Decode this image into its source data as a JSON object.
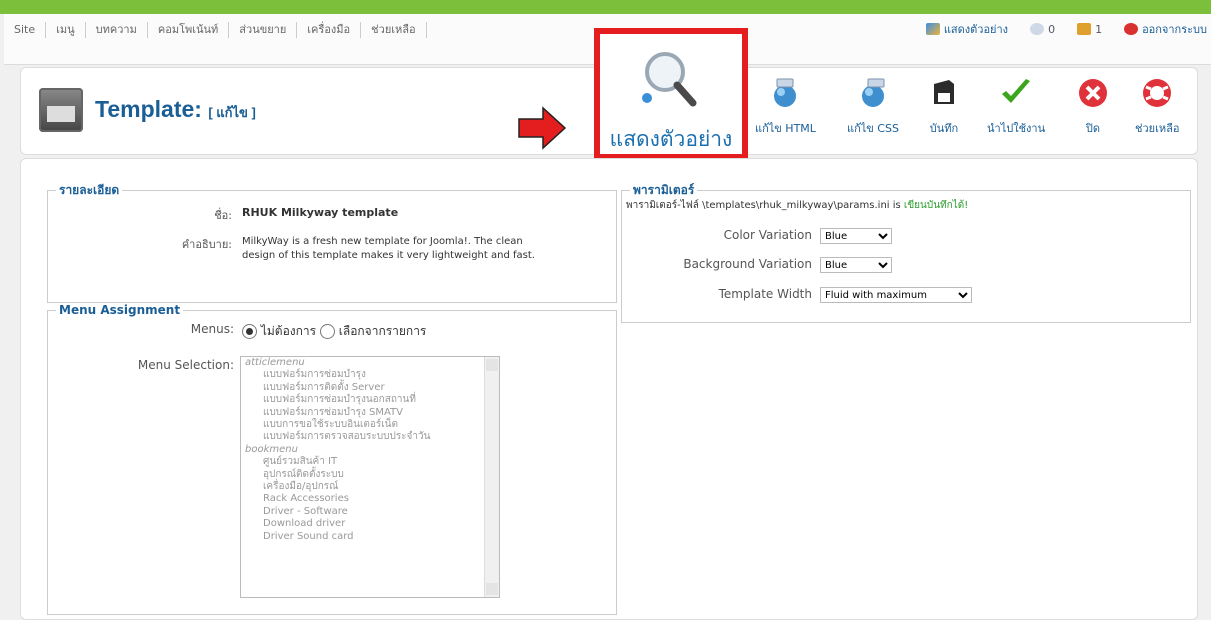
{
  "menu": [
    "Site",
    "เมนู",
    "บทความ",
    "คอมโพเน้นท์",
    "ส่วนขยาย",
    "เครื่องมือ",
    "ช่วยเหลือ"
  ],
  "status": {
    "preview": "แสดงตัวอย่าง",
    "messages_count": "0",
    "users_count": "1",
    "logout": "ออกจากระบบ"
  },
  "header": {
    "title": "Template:",
    "subtitle": "[ แก้ไข ]"
  },
  "toolbar": {
    "preview": "แสดงตัวอย่าง",
    "edit_html": "แก้ไข HTML",
    "edit_css": "แก้ไข CSS",
    "save": "บันทึก",
    "apply": "นำไปใช้งาน",
    "close": "ปิด",
    "help": "ช่วยเหลือ"
  },
  "details": {
    "legend": "รายละเอียด",
    "name_label": "ชื่อ:",
    "name_value": "RHUK Milkyway template",
    "desc_label": "คำอธิบาย:",
    "desc_value_1": "MilkyWay is a fresh new template for Joomla!. The clean",
    "desc_value_2": "design of this template makes it very lightweight and fast."
  },
  "menu_assignment": {
    "legend": "Menu Assignment",
    "menus_label": "Menus:",
    "option_none": "ไม่ต้องการ",
    "option_select": "เลือกจากรายการ",
    "selection_label": "Menu Selection:",
    "list": [
      {
        "group": "atticlemenu"
      },
      "แบบฟอร์มการซ่อมบำรุง",
      "แบบฟอร์มการติดตั้ง Server",
      "แบบฟอร์มการซ่อมบำรุงนอกสถานที่",
      "แบบฟอร์มการซ่อมบำรุง SMATV",
      "แบบการขอใช้ระบบอินเตอร์เน็ต",
      "แบบฟอร์มการตรวจสอบระบบประจำวัน",
      {
        "group": "bookmenu"
      },
      "ศูนย์รวมสินค้า IT",
      "อุปกรณ์ติดตั้งระบบ",
      "เครื่องมือ/อุปกรณ์",
      "Rack Accessories",
      "Driver - Software",
      "Download driver",
      "Driver Sound card"
    ]
  },
  "params": {
    "legend": "พารามิเตอร์",
    "file_note_prefix": "พารามิเตอร์-ไฟล์ \\templates\\rhuk_milkyway\\params.ini is ",
    "file_note_status": "เขียนบันทึกได้!",
    "rows": [
      {
        "label": "Color Variation",
        "value": "Blue"
      },
      {
        "label": "Background Variation",
        "value": "Blue"
      },
      {
        "label": "Template Width",
        "value": "Fluid with maximum"
      }
    ]
  }
}
